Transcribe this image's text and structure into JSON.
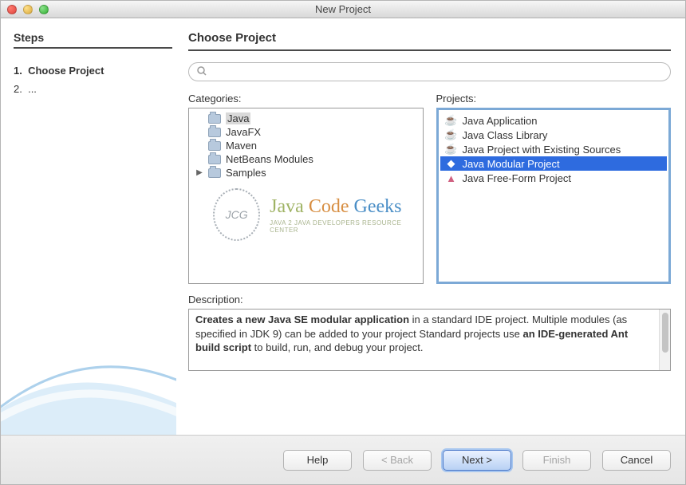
{
  "window": {
    "title": "New Project"
  },
  "sidebar": {
    "heading": "Steps",
    "steps": [
      {
        "num": "1.",
        "label": "Choose Project",
        "current": true
      },
      {
        "num": "2.",
        "label": "...",
        "current": false
      }
    ]
  },
  "main": {
    "heading": "Choose Project",
    "search": {
      "placeholder": ""
    },
    "categories": {
      "label": "Categories:",
      "items": [
        {
          "name": "Java",
          "selected": true,
          "expandable": false
        },
        {
          "name": "JavaFX",
          "selected": false,
          "expandable": false
        },
        {
          "name": "Maven",
          "selected": false,
          "expandable": false
        },
        {
          "name": "NetBeans Modules",
          "selected": false,
          "expandable": false
        },
        {
          "name": "Samples",
          "selected": false,
          "expandable": true
        }
      ]
    },
    "projects": {
      "label": "Projects:",
      "items": [
        {
          "name": "Java Application",
          "icon": "coffee",
          "selected": false
        },
        {
          "name": "Java Class Library",
          "icon": "coffee",
          "selected": false
        },
        {
          "name": "Java Project with Existing Sources",
          "icon": "coffee",
          "selected": false
        },
        {
          "name": "Java Modular Project",
          "icon": "diamond",
          "selected": true
        },
        {
          "name": "Java Free-Form Project",
          "icon": "triangle",
          "selected": false
        }
      ]
    },
    "description": {
      "label": "Description:",
      "text_pre": "Creates a new Java SE modular application",
      "text_mid1": " in a standard IDE project. Multiple modules (as specified in JDK 9) can be added to your project Standard projects use ",
      "text_bold2": "an IDE-generated Ant build script",
      "text_mid2": " to build, run, and debug your project."
    }
  },
  "footer": {
    "help": "Help",
    "back": "< Back",
    "next": "Next >",
    "finish": "Finish",
    "cancel": "Cancel"
  },
  "watermark": {
    "circle": "JCG",
    "java": "Java",
    "code": "Code",
    "geeks": "Geeks",
    "sub": "Java 2 Java Developers Resource Center"
  }
}
